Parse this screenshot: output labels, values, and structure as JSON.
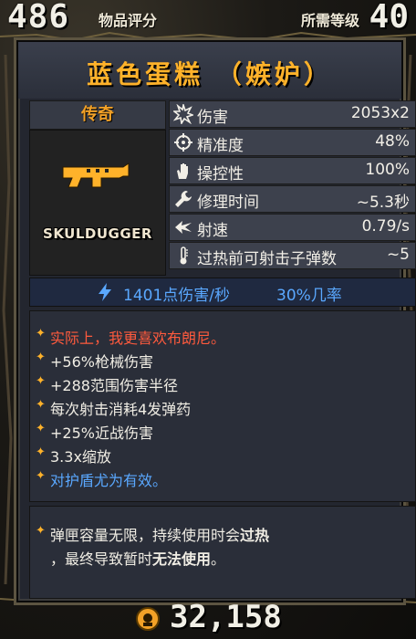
{
  "header": {
    "item_score": "486",
    "item_score_label": "物品评分",
    "required_level_label": "所需等级",
    "required_level": "40"
  },
  "item": {
    "name": "蓝色蛋糕 （嫉妒）",
    "rarity": "传奇",
    "manufacturer": "SKULDUGGER",
    "rarity_color": "#f2a127",
    "title_color": "#ffb22a"
  },
  "stats": [
    {
      "icon": "burst-damage-icon",
      "label": "伤害",
      "value": "2053x2"
    },
    {
      "icon": "crosshair-accuracy-icon",
      "label": "精准度",
      "value": "48%"
    },
    {
      "icon": "hand-handling-icon",
      "label": "操控性",
      "value": "100%"
    },
    {
      "icon": "wrench-reload-icon",
      "label": "修理时间",
      "value": "~5.3秒"
    },
    {
      "icon": "fire-rate-icon",
      "label": "射速",
      "value": "0.79/s"
    },
    {
      "icon": "thermometer-heat-icon",
      "label": "过热前可射击子弹数",
      "value": "~5"
    }
  ],
  "dps": {
    "text": "1401点伤害/秒",
    "crit": "30%几率",
    "color": "#5aa8ff"
  },
  "card_lines": [
    {
      "text": "实际上，我更喜欢布朗尼。",
      "color": "#ff5a3d"
    },
    {
      "text": "+56%枪械伤害",
      "color": "#f0ede4"
    },
    {
      "text": "+288范围伤害半径",
      "color": "#f0ede4"
    },
    {
      "text": "每次射击消耗4发弹药",
      "color": "#f0ede4"
    },
    {
      "text": "+25%近战伤害",
      "color": "#f0ede4"
    },
    {
      "text": "3.3x缩放",
      "color": "#f0ede4"
    },
    {
      "text": "对护盾尤为有效。",
      "color": "#5aa8ff"
    }
  ],
  "note": {
    "line1": "弹匣容量无限，持续使用时会",
    "line1_bold": "过热",
    "line2": "，最终导致暂时",
    "line2_bold": "无法使用",
    "line2_end": "。"
  },
  "price": "32,158"
}
